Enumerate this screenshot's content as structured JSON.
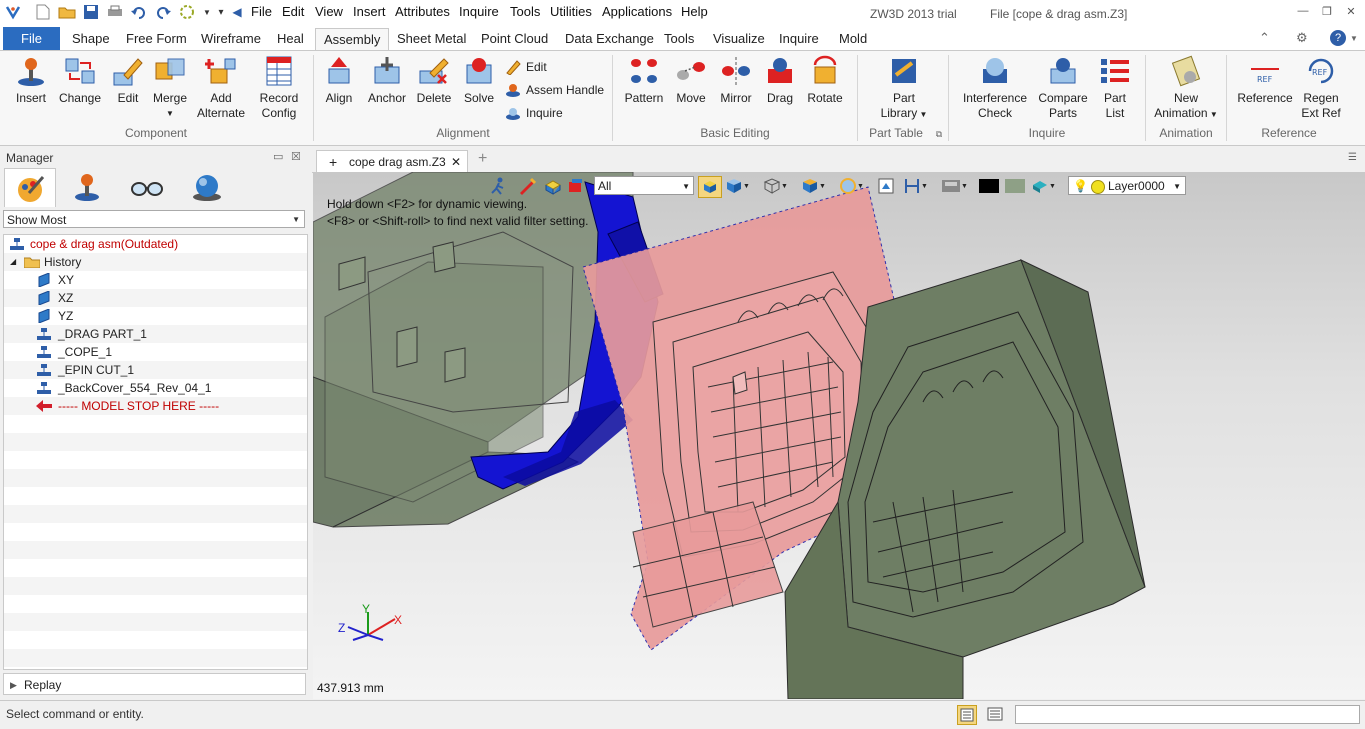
{
  "titlebar": {
    "menus": [
      "File",
      "Edit",
      "View",
      "Insert",
      "Attributes",
      "Inquire",
      "Tools",
      "Utilities",
      "Applications",
      "Help"
    ],
    "product": "ZW3D 2013 trial",
    "file": "File [cope & drag asm.Z3]"
  },
  "ribbon_tabs": [
    "File",
    "Shape",
    "Free Form",
    "Wireframe",
    "Heal",
    "Assembly",
    "Sheet Metal",
    "Point Cloud",
    "Data Exchange",
    "Tools",
    "Visualize",
    "Inquire",
    "Mold"
  ],
  "active_tab": "Assembly",
  "ribbon": {
    "component": {
      "label": "Component",
      "insert": "Insert",
      "change": "Change",
      "edit": "Edit",
      "merge": "Merge",
      "add_alt_1": "Add",
      "add_alt_2": "Alternate",
      "record_1": "Record",
      "record_2": "Config"
    },
    "alignment": {
      "label": "Alignment",
      "align": "Align",
      "anchor": "Anchor",
      "delete": "Delete",
      "solve": "Solve",
      "edit": "Edit",
      "assem_handle": "Assem Handle",
      "inquire": "Inquire"
    },
    "basic_editing": {
      "label": "Basic Editing",
      "pattern": "Pattern",
      "move": "Move",
      "mirror": "Mirror",
      "drag": "Drag",
      "rotate": "Rotate"
    },
    "part_table": {
      "label": "Part Table",
      "part_1": "Part",
      "part_2": "Library"
    },
    "inquire": {
      "label": "Inquire",
      "interf_1": "Interference",
      "interf_2": "Check",
      "compare_1": "Compare",
      "compare_2": "Parts",
      "partlist_1": "Part",
      "partlist_2": "List"
    },
    "animation": {
      "label": "Animation",
      "new_1": "New",
      "new_2": "Animation"
    },
    "reference": {
      "label": "Reference",
      "reference": "Reference",
      "regen_1": "Regen",
      "regen_2": "Ext Ref"
    }
  },
  "manager": {
    "title": "Manager",
    "filter": "Show Most",
    "root": "cope & drag asm(Outdated)",
    "history": "History",
    "items": [
      "XY",
      "XZ",
      "YZ",
      "_DRAG PART_1",
      "_COPE_1",
      "_EPIN CUT_1",
      "_BackCover_554_Rev_04_1"
    ],
    "stop": "----- MODEL STOP HERE -----",
    "replay": "Replay"
  },
  "viewport": {
    "doc_tab": "cope  drag asm.Z3",
    "filter": "All",
    "layer": "Layer0000",
    "hint_1": "Hold down <F2> for dynamic viewing.",
    "hint_2": "<F8> or <Shift-roll> to find next valid filter setting.",
    "measure": "437.913 mm",
    "axes": {
      "x": "X",
      "y": "Y",
      "z": "Z"
    }
  },
  "status": {
    "text": "Select command or entity."
  },
  "colors": {
    "file_tab": "#2b6cc0",
    "cope_green": "#6e7e64",
    "drag_blue": "#1414d2",
    "parting_pink": "#e89b9b",
    "root_red": "#c00000"
  }
}
